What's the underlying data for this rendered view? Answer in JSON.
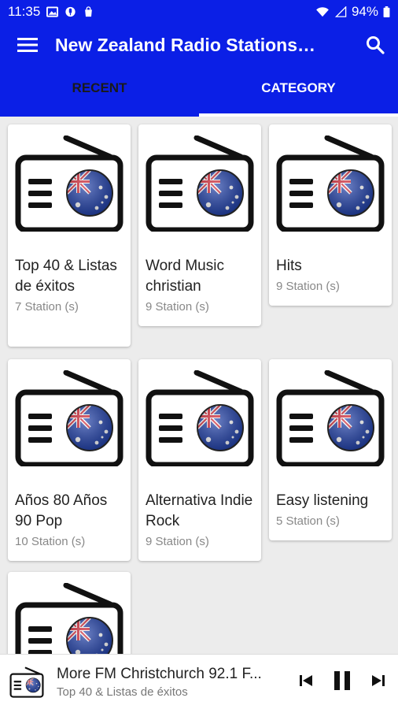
{
  "status": {
    "time": "11:35",
    "battery": "94%",
    "icons": [
      "image-icon",
      "mic-icon",
      "bag-icon",
      "wifi-icon",
      "signal-icon",
      "battery-icon"
    ]
  },
  "appbar": {
    "title": "New Zealand Radio Stations…",
    "menu_icon": "menu-icon",
    "search_icon": "search-icon"
  },
  "tabs": [
    {
      "label": "RECENT"
    },
    {
      "label": "CATEGORY"
    }
  ],
  "categories": [
    {
      "name": "Top 40 & Listas de éxitos",
      "count": "7 Station (s)"
    },
    {
      "name": "Word Music christian",
      "count": "9 Station (s)"
    },
    {
      "name": "Hits",
      "count": "9 Station (s)"
    },
    {
      "name": "Años 80 Años 90 Pop",
      "count": "10 Station (s)"
    },
    {
      "name": "Alternativa Indie Rock",
      "count": "9 Station (s)"
    },
    {
      "name": "Easy listening",
      "count": "5 Station (s)"
    },
    {
      "name": "",
      "count": ""
    }
  ],
  "player": {
    "title": "More FM Christchurch 92.1 F...",
    "subtitle": "Top 40 & Listas de éxitos"
  },
  "colors": {
    "primary": "#0b1fe6",
    "background": "#ececec",
    "card": "#ffffff"
  }
}
